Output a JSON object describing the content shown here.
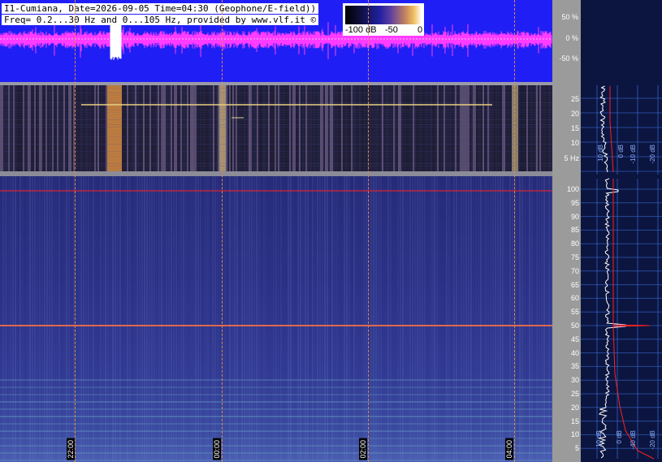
{
  "header": {
    "line1": "I1-Cumiana, Date=2026-09-05 Time=04:30 (Geophone/E-field))",
    "line2": "Freq= 0.2...30 Hz and 0...105 Hz, provided by www.vlf.it ©"
  },
  "legend": {
    "min_label": "-100 dB",
    "mid_label": "-50",
    "max_label": "0"
  },
  "amplitude_axis": {
    "labels": [
      "50 %",
      "0 %",
      "-50 %"
    ]
  },
  "low_freq_axis": {
    "labels": [
      "25",
      "20",
      "15",
      "10",
      "5 Hz"
    ]
  },
  "high_freq_axis": {
    "labels": [
      "100",
      "95",
      "90",
      "85",
      "80",
      "75",
      "70",
      "65",
      "60",
      "55",
      "50",
      "45",
      "40",
      "35",
      "30",
      "25",
      "20",
      "15",
      "10",
      "5"
    ]
  },
  "time_markers": [
    "22:00",
    "00:00",
    "02:00",
    "04:00"
  ],
  "right_panel": {
    "top_labels": [
      "10 dB",
      "0 dB",
      "-10 dB",
      "-20 dB"
    ],
    "bottom_labels": [
      "10 dB",
      "0 dB",
      "-40 dB",
      "-20 dB"
    ]
  },
  "colors": {
    "amplitude_bg": "#1f1ff5",
    "amplitude_trace": "#ff3cff",
    "marker_line": "#e08a4a",
    "reference_line": "#ff2020"
  }
}
